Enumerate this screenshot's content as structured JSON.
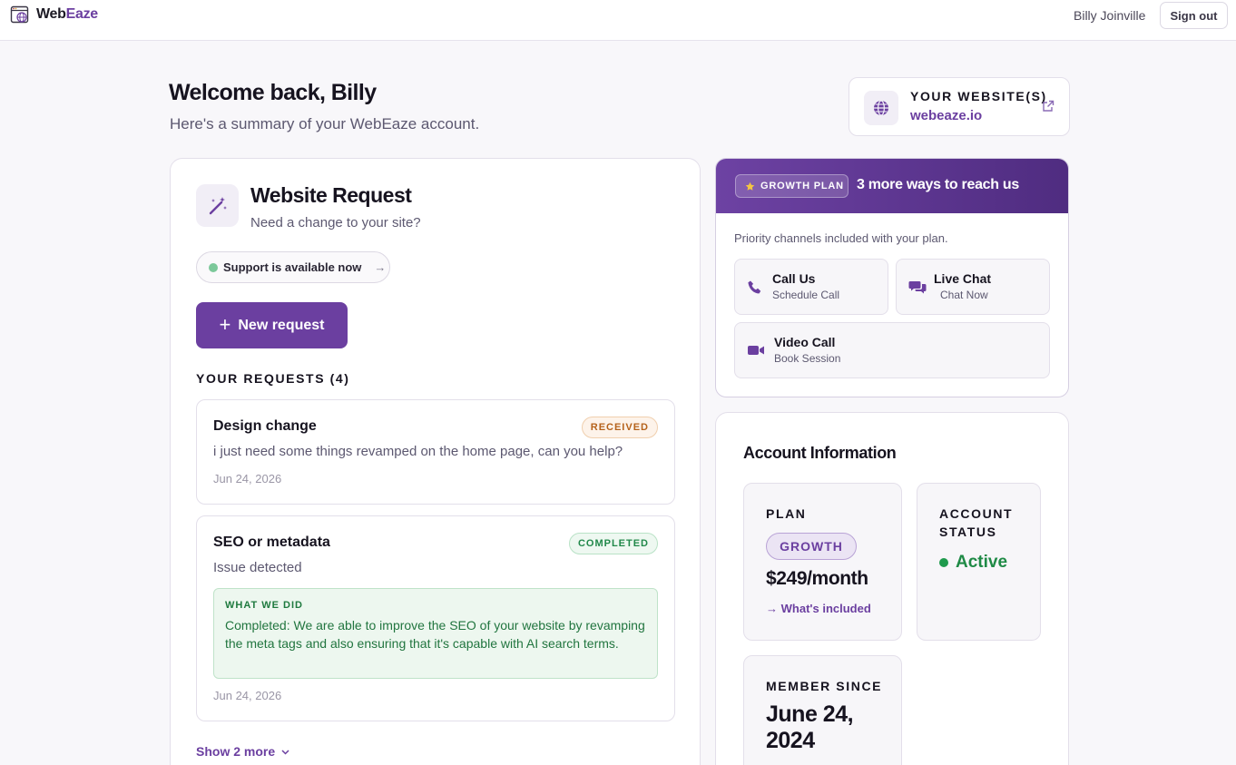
{
  "topbar": {
    "brand_part1": "Web",
    "brand_part2": "Eaze",
    "user_name": "Billy Joinville",
    "signout_label": "Sign out"
  },
  "header": {
    "welcome": "Welcome back, Billy",
    "summary": "Here's a summary of your WebEaze account."
  },
  "website_card": {
    "label": "YOUR WEBSITE(S)",
    "value": "webeaze.io",
    "icon": "globe-icon"
  },
  "request_card": {
    "title": "Website Request",
    "subtitle": "Need a change to your site?",
    "support_label": "Support is available now",
    "new_request_label": "New request",
    "requests_heading": "YOUR REQUESTS (4)",
    "requests": [
      {
        "title": "Design change",
        "status": "RECEIVED",
        "description": "i just need some things revamped on the home page, can you help?",
        "date": "Jun 24, 2026"
      },
      {
        "title": "SEO or metadata",
        "status": "COMPLETED",
        "description": "Issue detected",
        "what_we_did_label": "WHAT WE DID",
        "what_we_did": "Completed: We are able to improve the SEO of your website by revamping the meta tags and also ensuring that it's capable with AI search terms.",
        "date": "Jun 24, 2026"
      }
    ],
    "show_more_label": "Show 2 more"
  },
  "growth_card": {
    "plan_pill": "GROWTH PLAN",
    "title": "3 more ways to reach us",
    "subtitle": "Priority channels included with your plan.",
    "channels": [
      {
        "title": "Call Us",
        "sub": "Schedule Call",
        "icon": "phone-icon"
      },
      {
        "title": "Live Chat",
        "sub": "Chat Now",
        "icon": "chat-icon"
      },
      {
        "title": "Video Call",
        "sub": "Book Session",
        "icon": "video-icon"
      }
    ]
  },
  "account": {
    "title": "Account Information",
    "plan_label": "PLAN",
    "plan_tag": "GROWTH",
    "price": "$249/month",
    "included_label": "What's included",
    "status_label": "ACCOUNT STATUS",
    "status_value": "Active",
    "member_label": "MEMBER SINCE",
    "member_value": "June 24, 2024"
  },
  "colors": {
    "brand": "#6b3fa0",
    "success": "#1f8a46",
    "warning": "#b5621b"
  }
}
